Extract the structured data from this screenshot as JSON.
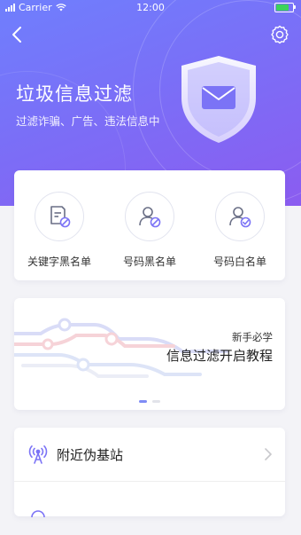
{
  "status_bar": {
    "carrier": "Carrier",
    "time": "12:00"
  },
  "header": {
    "title": "垃圾信息过滤",
    "subtitle": "过滤诈骗、广告、违法信息中",
    "back_icon": "chevron-left-icon",
    "settings_icon": "gear-icon"
  },
  "features": [
    {
      "label": "关键字黑名单",
      "icon": "document-block-icon"
    },
    {
      "label": "号码黑名单",
      "icon": "user-block-icon"
    },
    {
      "label": "号码白名单",
      "icon": "user-check-icon"
    }
  ],
  "banner": {
    "small_text": "新手必学",
    "big_text": "信息过滤开启教程",
    "slides_count": 2,
    "active_slide": 1
  },
  "list": [
    {
      "label": "附近伪基站",
      "icon": "signal-tower-icon"
    }
  ],
  "colors": {
    "accent": "#7b73f6",
    "accent_light": "#8f98f9",
    "battery": "#3cd35b"
  }
}
